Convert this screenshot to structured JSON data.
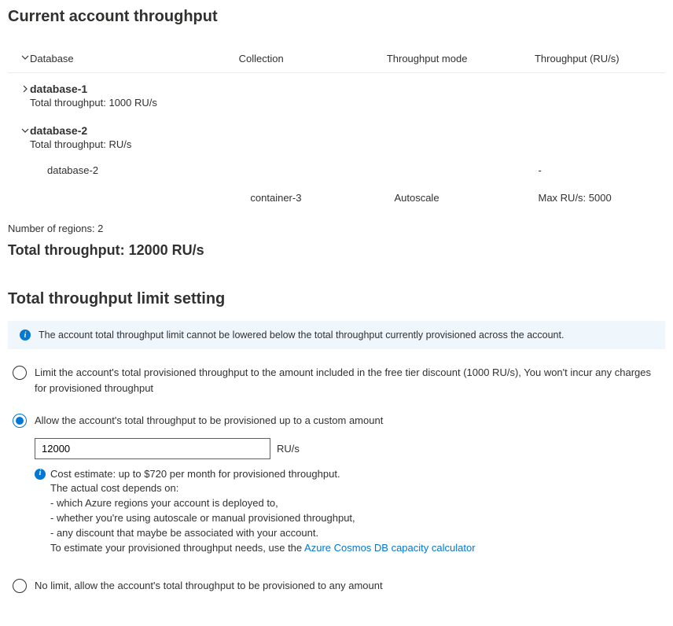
{
  "header": {
    "title": "Current account throughput"
  },
  "table": {
    "columns": {
      "database": "Database",
      "collection": "Collection",
      "mode": "Throughput mode",
      "throughput": "Throughput (RU/s)"
    },
    "databases": [
      {
        "name": "database-1",
        "subtitle": "Total throughput: 1000 RU/s",
        "expanded": false
      },
      {
        "name": "database-2",
        "subtitle": "Total throughput: RU/s",
        "expanded": true,
        "children": [
          {
            "database": "database-2",
            "collection": "",
            "mode": "",
            "throughput": "-"
          },
          {
            "database": "",
            "collection": "container-3",
            "mode": "Autoscale",
            "throughput": "Max RU/s: 5000"
          }
        ]
      }
    ]
  },
  "regions": {
    "label": "Number of regions: 2"
  },
  "total": {
    "label": "Total throughput: 12000 RU/s"
  },
  "limit_section": {
    "title": "Total throughput limit setting",
    "banner": "The account total throughput limit cannot be lowered below the total throughput currently provisioned across the account."
  },
  "options": {
    "free_tier": "Limit the account's total provisioned throughput to the amount included in the free tier discount (1000 RU/s), You won't incur any charges for provisioned throughput",
    "custom": "Allow the account's total throughput to be provisioned up to a custom amount",
    "no_limit": "No limit, allow the account's total throughput to be provisioned to any amount"
  },
  "custom_input": {
    "value": "12000",
    "unit": "RU/s"
  },
  "cost": {
    "line1": "Cost estimate: up to $720 per month for provisioned throughput.",
    "line2": "The actual cost depends on:",
    "bullet1": "- which Azure regions your account is deployed to,",
    "bullet2": "- whether you're using autoscale or manual provisioned throughput,",
    "bullet3": "- any discount that maybe be associated with your account.",
    "line3_prefix": "To estimate your provisioned throughput needs, use the ",
    "link": "Azure Cosmos DB capacity calculator"
  }
}
